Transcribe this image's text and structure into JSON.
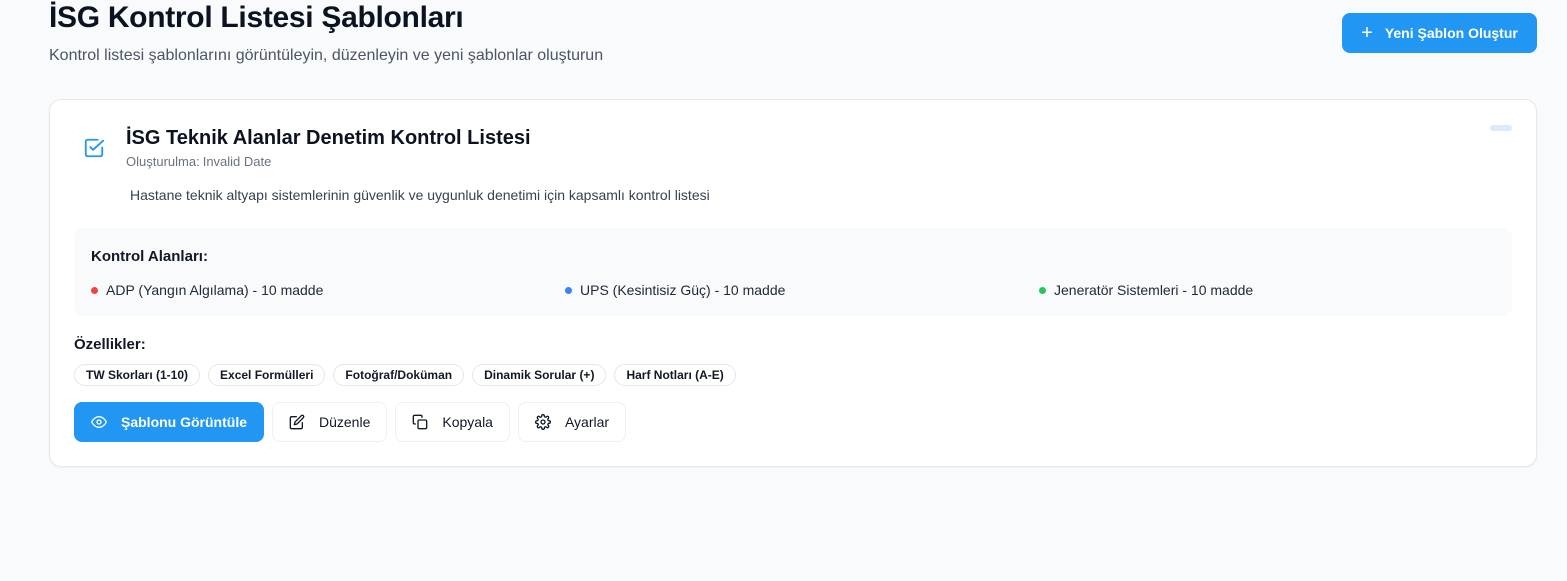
{
  "header": {
    "title": "İSG Kontrol Listesi Şablonları",
    "subtitle": "Kontrol listesi şablonlarını görüntüleyin, düzenleyin ve yeni şablonlar oluşturun",
    "new_button": {
      "icon": "plus-icon",
      "label": "Yeni Şablon Oluştur"
    }
  },
  "colors": {
    "accent": "#2196f3",
    "dot_red": "#ef4444",
    "dot_blue": "#3b82f6",
    "dot_green": "#22c55e"
  },
  "template_card": {
    "icon": "checkbox-icon",
    "title": "İSG Teknik Alanlar Denetim Kontrol Listesi",
    "created_label": "Oluşturulma:",
    "created_value": "Invalid Date",
    "description": "Hastane teknik altyapı sistemlerinin güvenlik ve uygunluk denetimi için kapsamlı kontrol listesi",
    "areas_title": "Kontrol Alanları:",
    "areas": [
      {
        "label": "ADP (Yangın Algılama) - 10 madde",
        "color": "#ef4444"
      },
      {
        "label": "UPS (Kesintisiz Güç) - 10 madde",
        "color": "#3b82f6"
      },
      {
        "label": "Jeneratör Sistemleri - 10 madde",
        "color": "#22c55e"
      }
    ],
    "features_title": "Özellikler:",
    "features": [
      "TW Skorları (1-10)",
      "Excel Formülleri",
      "Fotoğraf/Doküman",
      "Dinamik Sorular (+)",
      "Harf Notları (A-E)"
    ],
    "actions": [
      {
        "label": "Şablonu Görüntüle",
        "icon": "eye-icon"
      },
      {
        "label": "Düzenle",
        "icon": "edit-icon"
      },
      {
        "label": "Kopyala",
        "icon": "copy-icon"
      },
      {
        "label": "Ayarlar",
        "icon": "gear-icon"
      }
    ]
  }
}
